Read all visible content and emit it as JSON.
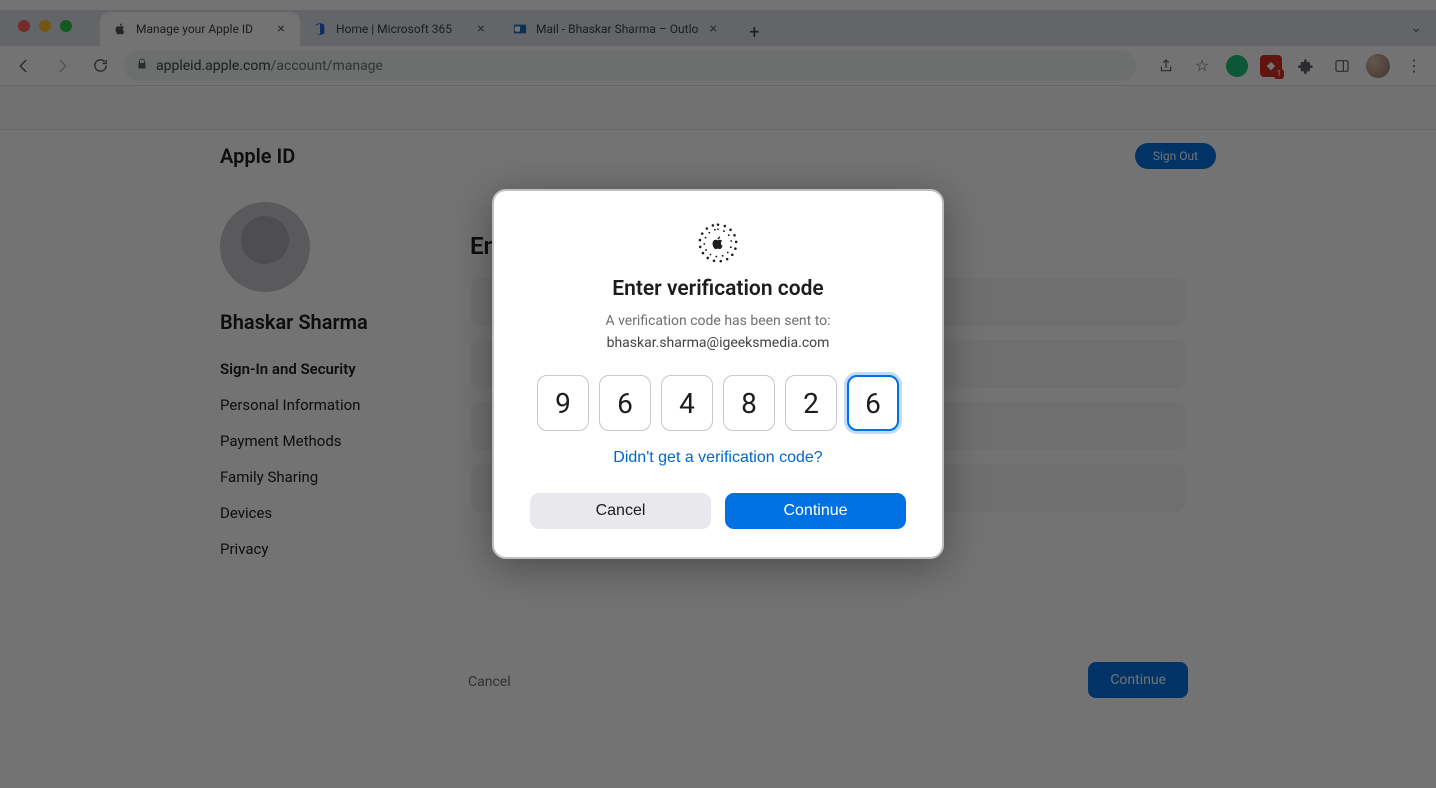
{
  "window": {
    "tabs": [
      {
        "title": "Manage your Apple ID",
        "active": true
      },
      {
        "title": "Home | Microsoft 365",
        "active": false
      },
      {
        "title": "Mail - Bhaskar Sharma – Outlo",
        "active": false
      }
    ],
    "url_display": "appleid.apple.com/account/manage",
    "url_prefix": "appleid.apple.com",
    "url_suffix": "/account/manage"
  },
  "page": {
    "brand": "Apple ID",
    "signout": "Sign Out",
    "profile": {
      "name": "Bhaskar Sharma",
      "subtext": ""
    },
    "nav": [
      "Sign-In and Security",
      "Personal Information",
      "Payment Methods",
      "Family Sharing",
      "Devices",
      "Privacy"
    ],
    "panel_title": "Email & Phone Numbers",
    "bluebtn": "Continue",
    "graylink": "Cancel"
  },
  "modal": {
    "title": "Enter verification code",
    "subtitle": "A verification code has been sent to:",
    "email": "bhaskar.sharma@igeeksmedia.com",
    "code": [
      "9",
      "6",
      "4",
      "8",
      "2",
      "6"
    ],
    "focus_index": 5,
    "resend_link": "Didn't get a verification code?",
    "cancel": "Cancel",
    "continue": "Continue"
  }
}
